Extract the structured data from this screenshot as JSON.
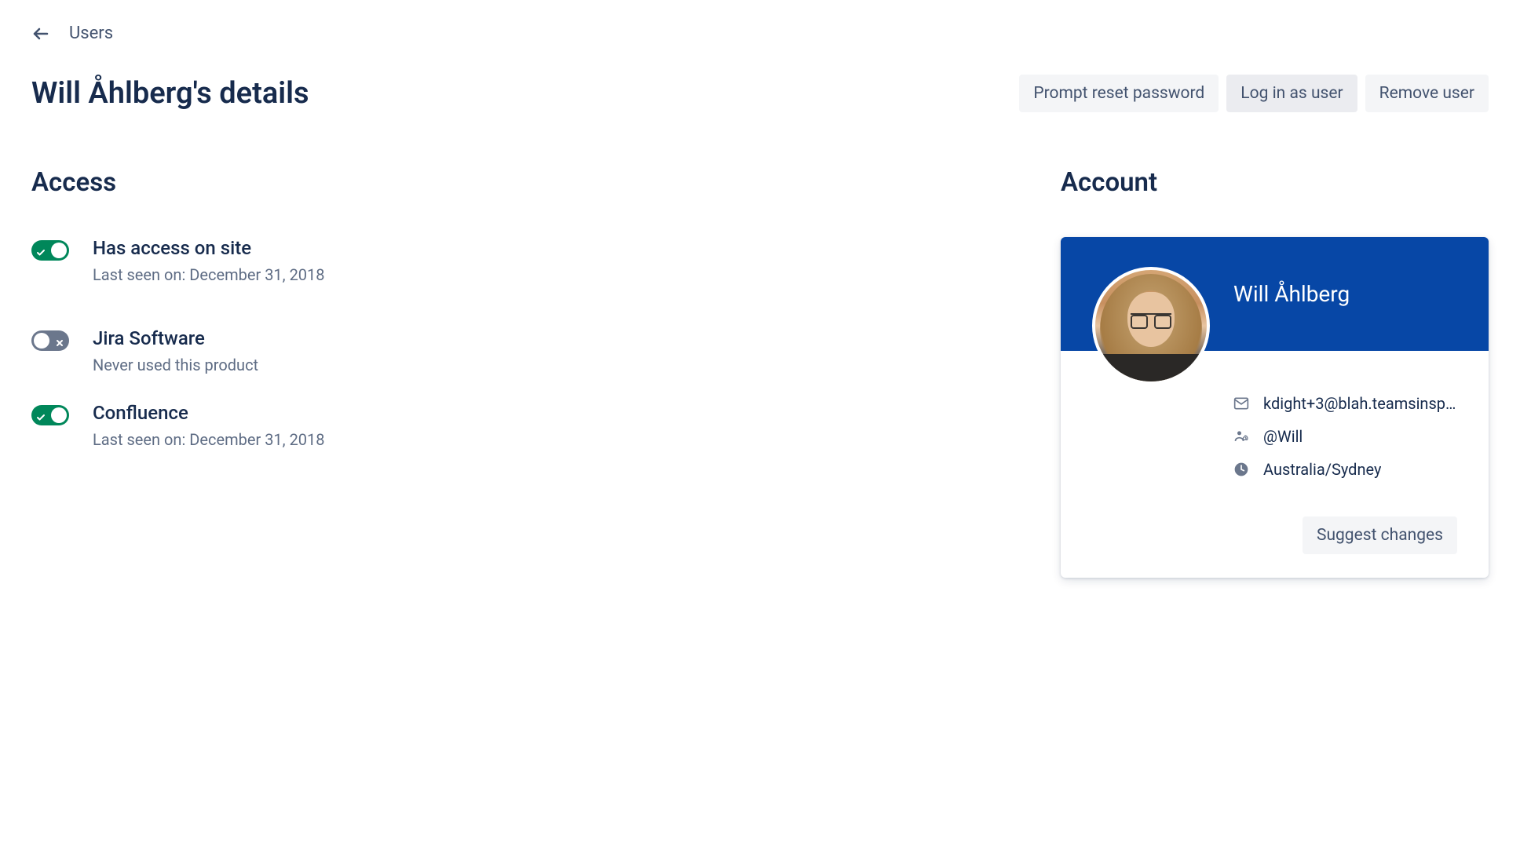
{
  "breadcrumb": {
    "label": "Users"
  },
  "header": {
    "title": "Will Åhlberg's details",
    "buttons": {
      "prompt_reset": "Prompt reset password",
      "login_as": "Log in as user",
      "remove": "Remove user"
    }
  },
  "access": {
    "title": "Access",
    "items": [
      {
        "label": "Has access on site",
        "sub": "Last seen on: December 31, 2018",
        "on": true
      },
      {
        "label": "Jira Software",
        "sub": "Never used this product",
        "on": false
      },
      {
        "label": "Confluence",
        "sub": "Last seen on: December 31, 2018",
        "on": true
      }
    ]
  },
  "account": {
    "title": "Account",
    "name": "Will Åhlberg",
    "email": "kdight+3@blah.teamsinspa…",
    "mention": "@Will",
    "timezone": "Australia/Sydney",
    "suggest_button": "Suggest changes"
  }
}
